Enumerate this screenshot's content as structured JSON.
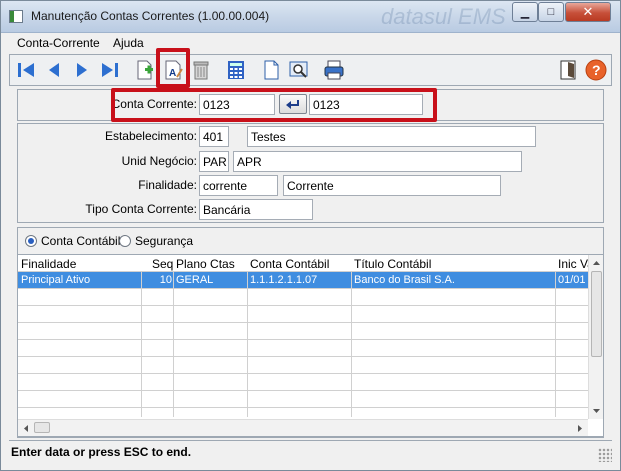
{
  "window": {
    "title": "Manutenção Contas Correntes (1.00.00.004)",
    "background_brand": "datasul EMS",
    "controls": {
      "minimize": "▁",
      "maximize": "□",
      "close": "✕"
    }
  },
  "menu": [
    "Conta-Corrente",
    "Ajuda"
  ],
  "toolbar": {
    "buttons": [
      "first-icon",
      "previous-icon",
      "next-icon",
      "last-icon",
      "add-icon",
      "edit-icon",
      "delete-icon",
      "calculator-icon",
      "document-icon",
      "zoom-icon",
      "print-icon",
      "exit-icon",
      "help-icon"
    ],
    "highlighted": "edit-icon",
    "accent": "#c8101a"
  },
  "header": {
    "conta_corrente_label": "Conta Corrente:",
    "conta_corrente_value": "0123",
    "conta_corrente_desc": "0123"
  },
  "form": {
    "estabelecimento_label": "Estabelecimento:",
    "estabelecimento_code": "401",
    "estabelecimento_name": "Testes",
    "unid_negocio_label": "Unid Negócio:",
    "unid_negocio_code": "PAR",
    "unid_negocio_name": "APR",
    "finalidade_label": "Finalidade:",
    "finalidade_code": "corrente",
    "finalidade_name": "Corrente",
    "tipo_label": "Tipo Conta Corrente:",
    "tipo_value": "Bancária"
  },
  "radios": {
    "option1": "Conta Contábil",
    "option2": "Segurança",
    "selected": "option1"
  },
  "table": {
    "columns": [
      "Finalidade",
      "Seq",
      "Plano Ctas",
      "Conta Contábil",
      "Título Contábil",
      "Inic Va"
    ],
    "rows": [
      {
        "finalidade": "Principal Ativo",
        "seq": "10",
        "plano": "GERAL",
        "conta": "1.1.1.2.1.1.07",
        "titulo": "Banco do Brasil S.A.",
        "inic": "01/01"
      }
    ]
  },
  "status": {
    "message": "Enter data or press ESC to end."
  }
}
